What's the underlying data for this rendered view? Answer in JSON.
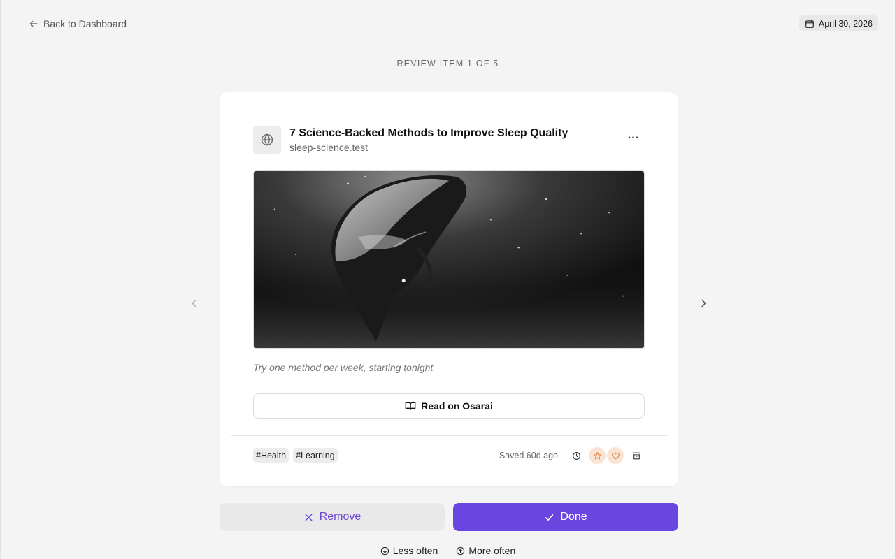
{
  "header": {
    "back_label": "Back to Dashboard",
    "date": "April 30, 2026"
  },
  "review_counter": "REVIEW ITEM 1 OF 5",
  "card": {
    "title": "7 Science-Backed Methods to Improve Sleep Quality",
    "domain": "sleep-science.test",
    "more_label": "...",
    "note": "Try one method per week, starting tonight",
    "read_label": "Read on Osarai",
    "tags": [
      "#Health",
      "#Learning"
    ],
    "saved_text": "Saved 60d ago"
  },
  "actions": {
    "remove_label": "Remove",
    "done_label": "Done",
    "less_often_label": "Less often",
    "more_often_label": "More often"
  },
  "colors": {
    "accent": "#6a45e0",
    "remove_text": "#6a45d6",
    "highlight_icon_bg": "#fbe3d4",
    "highlight_icon_fg": "#e07a3f"
  },
  "icons": {
    "back": "arrow-left-icon",
    "date": "calendar-icon",
    "site": "globe-icon",
    "read": "book-open-icon",
    "snooze": "clock-icon",
    "favorite": "star-icon",
    "love": "heart-icon",
    "archive": "archive-icon",
    "prev": "chevron-left-icon",
    "next": "chevron-right-icon",
    "remove": "x-icon",
    "done": "check-icon",
    "less_often": "arrow-down-circle-icon",
    "more_often": "arrow-up-circle-icon"
  }
}
